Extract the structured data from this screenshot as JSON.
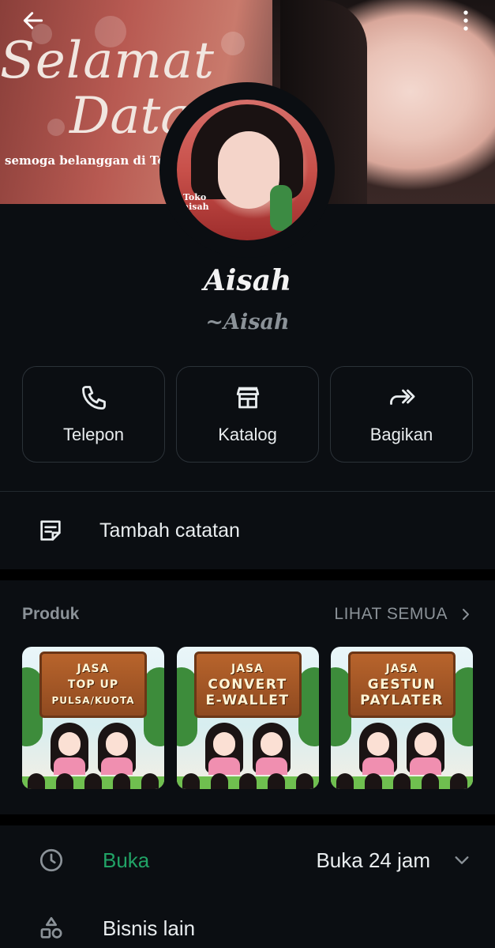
{
  "header": {
    "cover_line_1": "Selamat",
    "cover_line_2": "Data",
    "cover_line_3": "semoga belanggan di To",
    "avatar_label": "Toko aisah"
  },
  "profile": {
    "name": "Aisah",
    "subname": "~Aisah"
  },
  "actions": [
    {
      "label": "Telepon",
      "icon": "phone-icon"
    },
    {
      "label": "Katalog",
      "icon": "storefront-icon"
    },
    {
      "label": "Bagikan",
      "icon": "share-forward-icon"
    }
  ],
  "note": {
    "label": "Tambah catatan",
    "icon": "note-icon"
  },
  "products": {
    "title": "Produk",
    "see_all": "LIHAT SEMUA",
    "items": [
      {
        "line1": "JASA",
        "line2": "TOP UP",
        "line3": "PULSA/KUOTA"
      },
      {
        "line1": "JASA",
        "line2": "CONVERT",
        "line3": "E-WALLET"
      },
      {
        "line1": "JASA",
        "line2": "GESTUN",
        "line3": "PAYLATER"
      }
    ]
  },
  "hours": {
    "status": "Buka",
    "detail": "Buka 24 jam",
    "status_color": "#21a366"
  },
  "other_business": {
    "label": "Bisnis lain"
  }
}
